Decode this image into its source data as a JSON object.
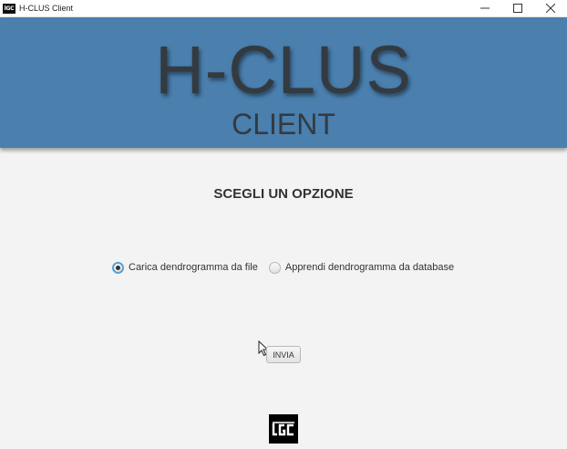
{
  "window": {
    "title": "H-CLUS Client",
    "controls": {
      "minimize": "—",
      "maximize": "☐",
      "close": "✕"
    }
  },
  "header": {
    "title": "H-CLUS",
    "subtitle": "CLIENT",
    "background": "#4a7fae"
  },
  "main": {
    "heading": "SCEGLI UN OPZIONE",
    "options": [
      {
        "label": "Carica dendrogramma da file",
        "selected": true
      },
      {
        "label": "Apprendi dendrogramma da database",
        "selected": false
      }
    ],
    "submit_label": "INVIA"
  },
  "icons": {
    "app": "app-logo-icon",
    "footer": "lgc-logo-icon",
    "cursor": "mouse-pointer-icon"
  }
}
